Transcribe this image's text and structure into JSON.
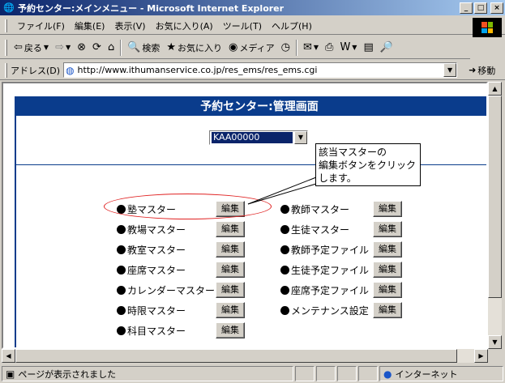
{
  "window": {
    "title": "予約センター:メインメニュー - Microsoft Internet Explorer",
    "minimize": "_",
    "maximize": "□",
    "close": "×"
  },
  "menu": [
    "ファイル(F)",
    "編集(E)",
    "表示(V)",
    "お気に入り(A)",
    "ツール(T)",
    "ヘルプ(H)"
  ],
  "toolbar": {
    "back": "戻る",
    "search": "検索",
    "favorites": "お気に入り",
    "media": "メディア"
  },
  "address": {
    "label": "アドレス(D)",
    "url": "http://www.ithumanservice.co.jp/res_ems/res_ems.cgi",
    "go": "移動"
  },
  "page": {
    "header": "予約センター:管理画面",
    "selected_code": "KAA00000",
    "edit_label": "編集",
    "left_items": [
      "塾マスター",
      "教場マスター",
      "教室マスター",
      "座席マスター",
      "カレンダーマスター",
      "時限マスター",
      "科目マスター"
    ],
    "right_items": [
      "教師マスター",
      "生徒マスター",
      "教師予定ファイル",
      "生徒予定ファイル",
      "座席予定ファイル",
      "メンテナンス設定"
    ],
    "callout": [
      "該当マスターの",
      "編集ボタンをクリック",
      "します。"
    ]
  },
  "status": {
    "text": "ページが表示されました",
    "zone": "インターネット"
  },
  "colors": {
    "header_bg": "#0a3c8c",
    "highlight": "#e02020"
  }
}
